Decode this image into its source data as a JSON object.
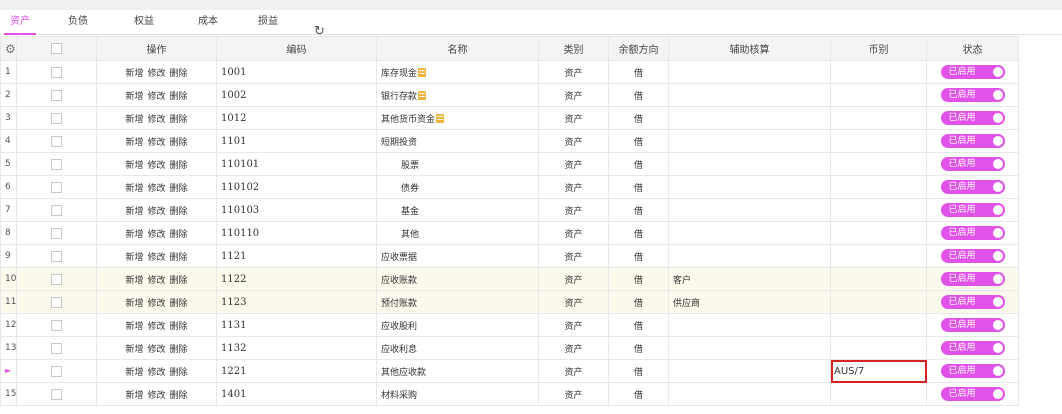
{
  "tabs": [
    {
      "label": "资产",
      "active": true
    },
    {
      "label": "负债"
    },
    {
      "label": "权益"
    },
    {
      "label": "成本"
    },
    {
      "label": "损益"
    }
  ],
  "refresh_icon": "refresh-icon",
  "columns": {
    "settings_icon": "gear-icon",
    "operations": "操作",
    "code": "编码",
    "name": "名称",
    "category": "类别",
    "balance_direction": "余额方向",
    "aux": "辅助核算",
    "currency": "币别",
    "status": "状态"
  },
  "ops": {
    "add": "新增",
    "edit": "修改",
    "delete": "删除"
  },
  "status_label": "已启用",
  "colors": {
    "accent": "#e153e8",
    "highlight_row": "#fbf8ec",
    "focus_border": "#d42323"
  },
  "rows": [
    {
      "num": "1",
      "code": "1001",
      "name": "库存现金",
      "cat": "资产",
      "dir": "借",
      "aux": "",
      "curr": ""
    },
    {
      "num": "2",
      "code": "1002",
      "name": "银行存款",
      "cat": "资产",
      "dir": "借",
      "aux": "",
      "curr": ""
    },
    {
      "num": "3",
      "code": "1012",
      "name": "其他货币资金",
      "cat": "资产",
      "dir": "借",
      "aux": "",
      "curr": ""
    },
    {
      "num": "4",
      "code": "1101",
      "name": "短期投资",
      "cat": "资产",
      "dir": "借",
      "aux": "",
      "curr": ""
    },
    {
      "num": "5",
      "code": "110101",
      "name": "股票",
      "cat": "资产",
      "dir": "借",
      "aux": "",
      "curr": ""
    },
    {
      "num": "6",
      "code": "110102",
      "name": "债券",
      "cat": "资产",
      "dir": "借",
      "aux": "",
      "curr": ""
    },
    {
      "num": "7",
      "code": "110103",
      "name": "基金",
      "cat": "资产",
      "dir": "借",
      "aux": "",
      "curr": ""
    },
    {
      "num": "8",
      "code": "110110",
      "name": "其他",
      "cat": "资产",
      "dir": "借",
      "aux": "",
      "curr": ""
    },
    {
      "num": "9",
      "code": "1121",
      "name": "应收票据",
      "cat": "资产",
      "dir": "借",
      "aux": "",
      "curr": ""
    },
    {
      "num": "10",
      "code": "1122",
      "name": "应收账款",
      "cat": "资产",
      "dir": "借",
      "aux": "客户",
      "curr": ""
    },
    {
      "num": "11",
      "code": "1123",
      "name": "预付账款",
      "cat": "资产",
      "dir": "借",
      "aux": "供应商",
      "curr": ""
    },
    {
      "num": "12",
      "code": "1131",
      "name": "应收股利",
      "cat": "资产",
      "dir": "借",
      "aux": "",
      "curr": ""
    },
    {
      "num": "13",
      "code": "1132",
      "name": "应收利息",
      "cat": "资产",
      "dir": "借",
      "aux": "",
      "curr": ""
    },
    {
      "num": "",
      "code": "1221",
      "name": "其他应收款",
      "cat": "资产",
      "dir": "借",
      "aux": "",
      "curr": "AUS/7"
    },
    {
      "num": "15",
      "code": "1401",
      "name": "材料采购",
      "cat": "资产",
      "dir": "借",
      "aux": "",
      "curr": ""
    }
  ]
}
